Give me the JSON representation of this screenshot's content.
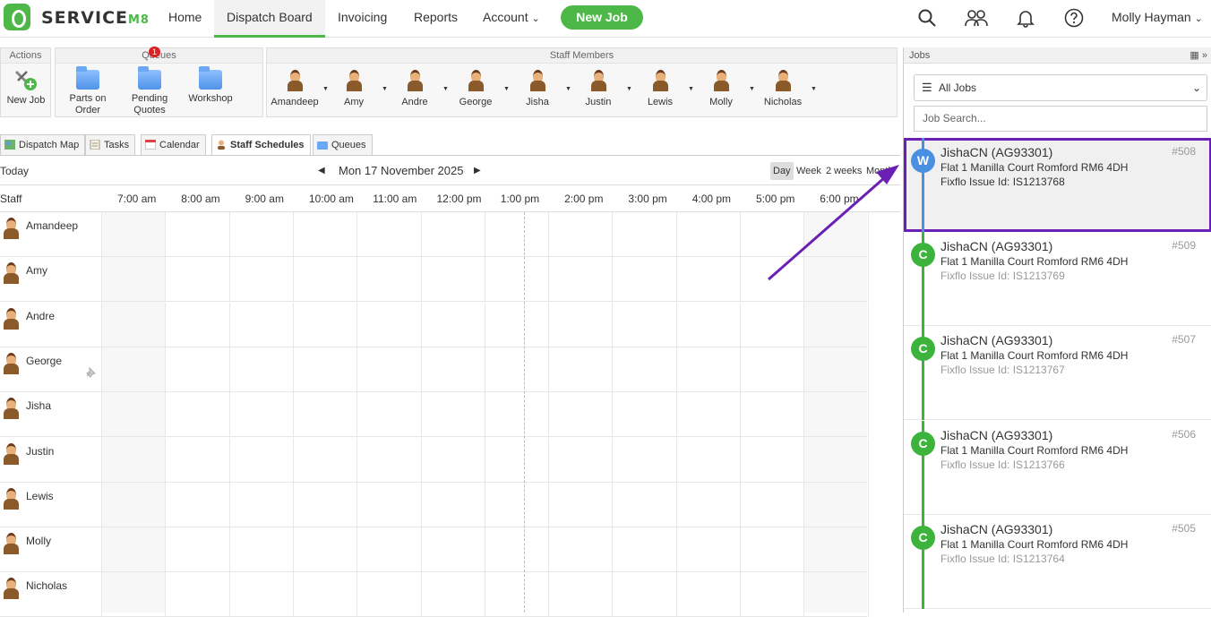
{
  "brand": {
    "name": "SERVICE",
    "suffix": "M8",
    "accent": "#4db848"
  },
  "nav": {
    "home": "Home",
    "dispatch": "Dispatch Board",
    "invoicing": "Invoicing",
    "reports": "Reports",
    "account": "Account",
    "new_job": "New Job",
    "user": "Molly Hayman"
  },
  "toolbar": {
    "actions_title": "Actions",
    "new_job": "New Job",
    "queues_title": "Queues",
    "queues": [
      "Parts on Order",
      "Pending Quotes",
      "Workshop"
    ],
    "pending_badge": "1",
    "staff_title": "Staff Members",
    "staff": [
      "Amandeep",
      "Amy",
      "Andre",
      "George",
      "Jisha",
      "Justin",
      "Lewis",
      "Molly",
      "Nicholas"
    ]
  },
  "tabs": [
    "Dispatch Map",
    "Tasks",
    "Calendar",
    "Staff Schedules",
    "Queues"
  ],
  "calendar": {
    "today": "Today",
    "date": "Mon 17 November 2025",
    "views": [
      "Day",
      "Week",
      "2 weeks",
      "Month"
    ],
    "staff_header": "Staff",
    "hours": [
      "7:00 am",
      "8:00 am",
      "9:00 am",
      "10:00 am",
      "11:00 am",
      "12:00 pm",
      "1:00 pm",
      "2:00 pm",
      "3:00 pm",
      "4:00 pm",
      "5:00 pm",
      "6:00 pm"
    ],
    "staff": [
      "Amandeep",
      "Amy",
      "Andre",
      "George",
      "Jisha",
      "Justin",
      "Lewis",
      "Molly",
      "Nicholas"
    ]
  },
  "jobs": {
    "title": "Jobs",
    "filter": "All Jobs",
    "search_placeholder": "Job Search...",
    "items": [
      {
        "initial": "W",
        "client": "JishaCN (AG93301)",
        "address": "Flat 1 Manilla Court Romford RM6 4DH",
        "issue": "Fixflo Issue Id: IS1213768",
        "number": "#508",
        "color": "#4a90e2"
      },
      {
        "initial": "C",
        "client": "JishaCN (AG93301)",
        "address": "Flat 1 Manilla Court Romford RM6 4DH",
        "issue": "Fixflo Issue Id: IS1213769",
        "number": "#509",
        "color": "#3cb43c"
      },
      {
        "initial": "C",
        "client": "JishaCN (AG93301)",
        "address": "Flat 1 Manilla Court Romford RM6 4DH",
        "issue": "Fixflo Issue Id: IS1213767",
        "number": "#507",
        "color": "#3cb43c"
      },
      {
        "initial": "C",
        "client": "JishaCN (AG93301)",
        "address": "Flat 1 Manilla Court Romford RM6 4DH",
        "issue": "Fixflo Issue Id: IS1213766",
        "number": "#506",
        "color": "#3cb43c"
      },
      {
        "initial": "C",
        "client": "JishaCN (AG93301)",
        "address": "Flat 1 Manilla Court Romford RM6 4DH",
        "issue": "Fixflo Issue Id: IS1213764",
        "number": "#505",
        "color": "#3cb43c"
      }
    ]
  }
}
